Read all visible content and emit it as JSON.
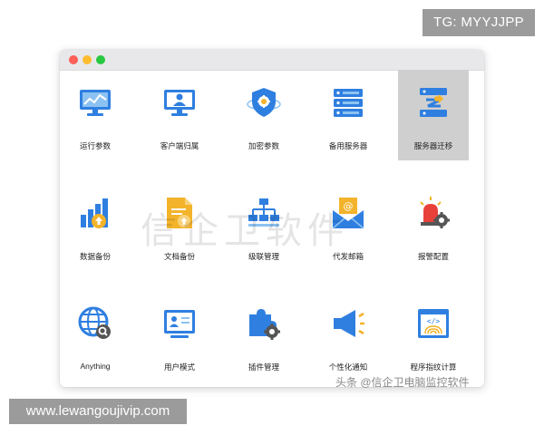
{
  "overlay": {
    "tg_badge": "TG: MYYJJPP",
    "url_badge": "www.lewangoujivip.com",
    "watermark": "信企卫软件",
    "source_mark": "头条 @信企卫电脑监控软件"
  },
  "colors": {
    "primary_blue": "#2f7fe0",
    "light_blue": "#8cc2f2",
    "accent_orange": "#f3b32a",
    "selected_tile": "#cfcfcf"
  },
  "grid": {
    "rows": [
      [
        {
          "label": "运行参数",
          "icon": "monitor-chart-icon"
        },
        {
          "label": "客户端归属",
          "icon": "monitor-user-icon"
        },
        {
          "label": "加密参数",
          "icon": "shield-gear-icon"
        },
        {
          "label": "备用服务器",
          "icon": "server-stack-icon"
        },
        {
          "label": "服务器迁移",
          "icon": "server-migrate-icon",
          "selected": true
        }
      ],
      [
        {
          "label": "数据备份",
          "icon": "bar-chart-upload-icon"
        },
        {
          "label": "文档备份",
          "icon": "document-upload-icon"
        },
        {
          "label": "级联管理",
          "icon": "hierarchy-icon"
        },
        {
          "label": "代发邮箱",
          "icon": "email-icon"
        },
        {
          "label": "报警配置",
          "icon": "alarm-gear-icon"
        }
      ],
      [
        {
          "label": "Anything",
          "icon": "globe-search-icon"
        },
        {
          "label": "用户模式",
          "icon": "user-card-icon"
        },
        {
          "label": "插件管理",
          "icon": "puzzle-gear-icon"
        },
        {
          "label": "个性化通知",
          "icon": "megaphone-icon"
        },
        {
          "label": "程序指纹计算",
          "icon": "fingerprint-window-icon"
        }
      ]
    ]
  }
}
